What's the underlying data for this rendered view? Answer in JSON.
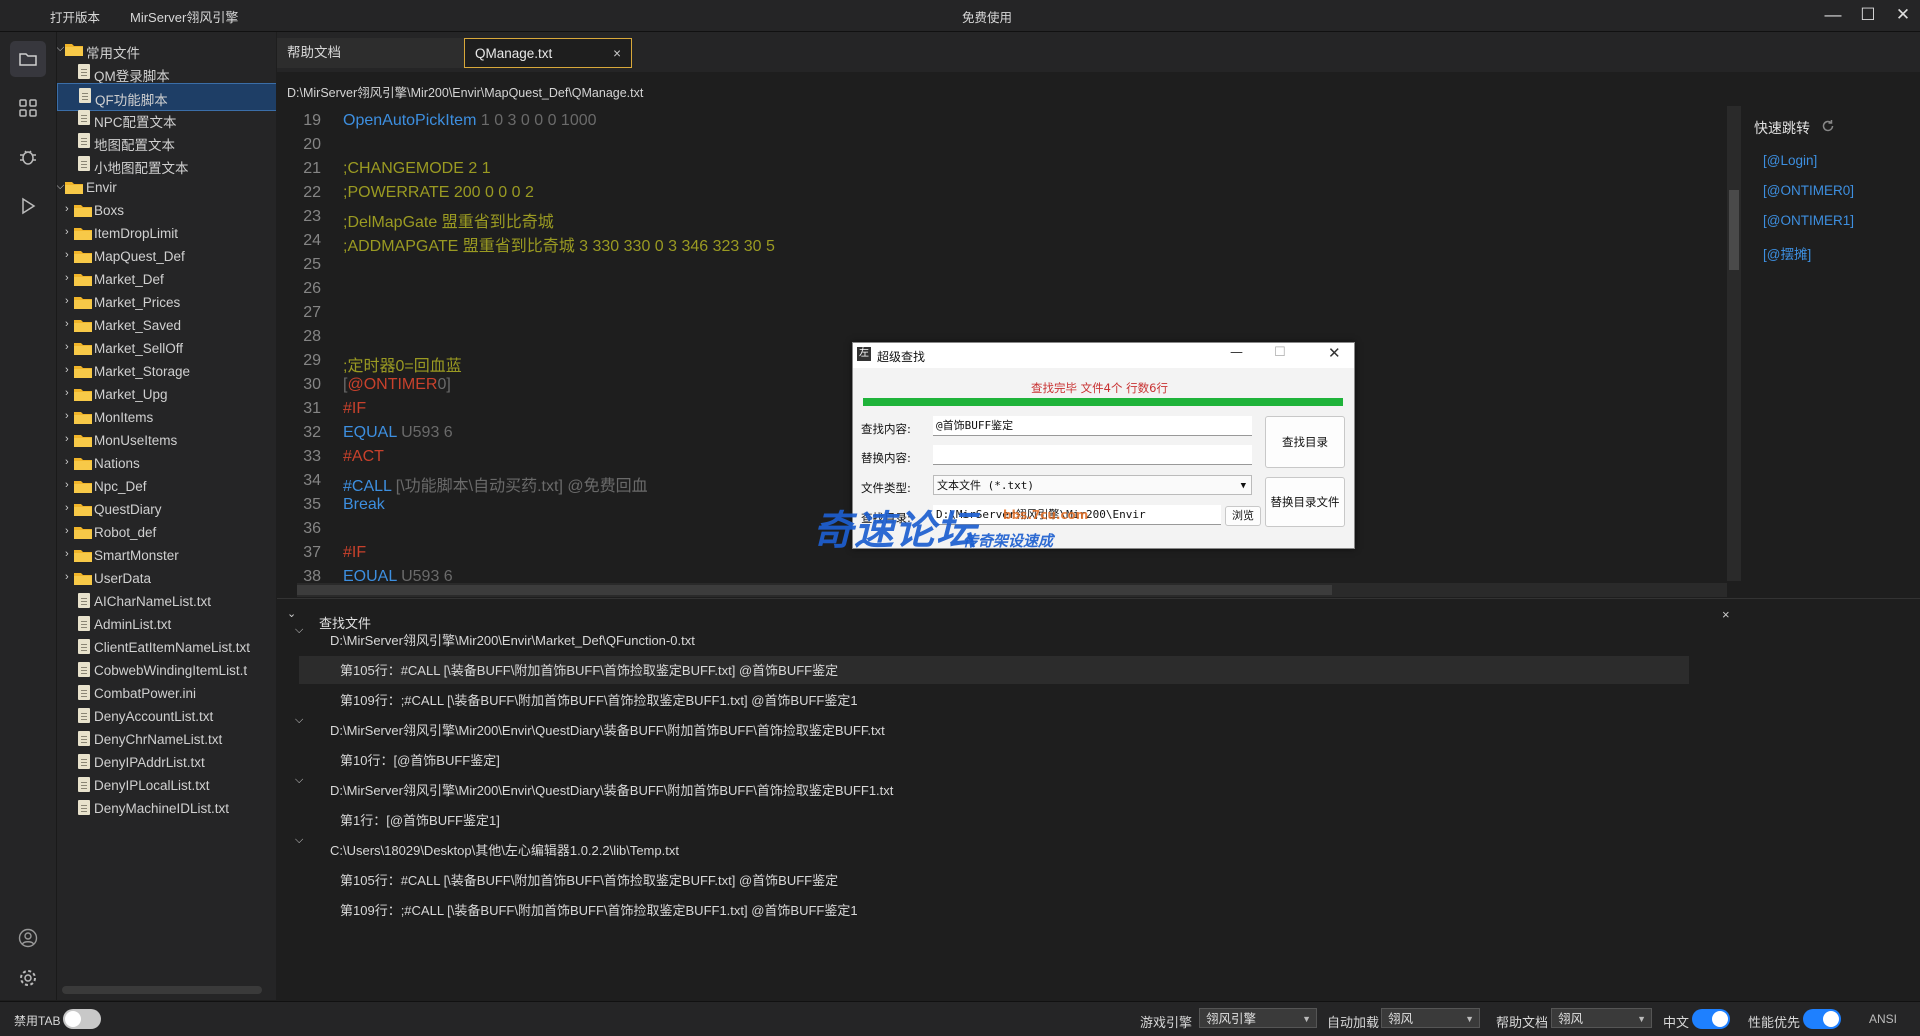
{
  "titlebar": {
    "open_version": "打开版本",
    "app_title": "MirServer翎风引擎",
    "center_label": "免费使用",
    "minimize": "—",
    "maximize": "☐",
    "close": "✕"
  },
  "sidebar_icons": [
    "folder-icon",
    "apps-grid-icon",
    "debug-bug-icon",
    "run-play-icon",
    "account-icon",
    "settings-gear-icon"
  ],
  "tree": {
    "groups": [
      {
        "label": "常用文件"
      },
      {
        "label": "Envir"
      }
    ],
    "common_files": [
      "QM登录脚本",
      "QF功能脚本",
      "NPC配置文本",
      "地图配置文本",
      "小地图配置文本"
    ],
    "envir_folders": [
      "Boxs",
      "ItemDropLimit",
      "MapQuest_Def",
      "Market_Def",
      "Market_Prices",
      "Market_Saved",
      "Market_SellOff",
      "Market_Storage",
      "Market_Upg",
      "MonItems",
      "MonUseItems",
      "Nations",
      "Npc_Def",
      "QuestDiary",
      "Robot_def",
      "SmartMonster",
      "UserData"
    ],
    "envir_files": [
      "AICharNameList.txt",
      "AdminList.txt",
      "ClientEatItemNameList.txt",
      "CobwebWindingItemList.t",
      "CombatPower.ini",
      "DenyAccountList.txt",
      "DenyChrNameList.txt",
      "DenyIPAddrList.txt",
      "DenyIPLocalList.txt",
      "DenyMachineIDList.txt"
    ]
  },
  "editor": {
    "tabs": [
      {
        "label": "帮助文档"
      },
      {
        "label": "QManage.txt",
        "close": "×"
      }
    ],
    "path": "D:\\MirServer翎风引擎\\Mir200\\Envir\\MapQuest_Def\\QManage.txt",
    "lines": [
      {
        "n": "19",
        "parts": [
          {
            "t": "OpenAutoPickItem",
            "c": "kw"
          },
          {
            "t": " 1 0 3 0 0 0 1000",
            "c": "gy"
          }
        ]
      },
      {
        "n": "20",
        "parts": []
      },
      {
        "n": "21",
        "parts": [
          {
            "t": ";CHANGEMODE 2 1",
            "c": "cm"
          }
        ]
      },
      {
        "n": "22",
        "parts": [
          {
            "t": ";POWERRATE 200 0 0 0 2",
            "c": "cm"
          }
        ]
      },
      {
        "n": "23",
        "parts": [
          {
            "t": ";DelMapGate 盟重省到比奇城",
            "c": "cm"
          }
        ]
      },
      {
        "n": "24",
        "parts": [
          {
            "t": ";ADDMAPGATE 盟重省到比奇城 3 330 330 0 3 346 323 30 5",
            "c": "cm"
          }
        ]
      },
      {
        "n": "25",
        "parts": []
      },
      {
        "n": "26",
        "parts": []
      },
      {
        "n": "27",
        "parts": []
      },
      {
        "n": "28",
        "parts": []
      },
      {
        "n": "29",
        "parts": [
          {
            "t": ";定时器0=回血蓝",
            "c": "cm"
          }
        ]
      },
      {
        "n": "30",
        "parts": [
          {
            "t": "[",
            "c": "gy"
          },
          {
            "t": "@ONTIMER",
            "c": "ev"
          },
          {
            "t": "0]",
            "c": "gy"
          }
        ]
      },
      {
        "n": "31",
        "parts": [
          {
            "t": "#IF",
            "c": "ev"
          }
        ]
      },
      {
        "n": "32",
        "parts": [
          {
            "t": "EQUAL",
            "c": "kw"
          },
          {
            "t": " U593 6",
            "c": "gy"
          }
        ]
      },
      {
        "n": "33",
        "parts": [
          {
            "t": "#ACT",
            "c": "ev"
          }
        ]
      },
      {
        "n": "34",
        "parts": [
          {
            "t": "#CALL",
            "c": "kw"
          },
          {
            "t": " [\\功能脚本\\自动买药.txt] @免费回血",
            "c": "gy"
          }
        ]
      },
      {
        "n": "35",
        "parts": [
          {
            "t": "Break",
            "c": "kw"
          }
        ]
      },
      {
        "n": "36",
        "parts": []
      },
      {
        "n": "37",
        "parts": [
          {
            "t": "#IF",
            "c": "ev"
          }
        ]
      },
      {
        "n": "38",
        "parts": [
          {
            "t": "EQUAL",
            "c": "kw"
          },
          {
            "t": " U593 6",
            "c": "gy"
          }
        ]
      }
    ]
  },
  "quick_jump": {
    "title": "快速跳转",
    "items": [
      "[@Login]",
      "[@ONTIMER0]",
      "[@ONTIMER1]",
      "[@摆摊]"
    ]
  },
  "results": {
    "title": "查找文件",
    "close": "×",
    "rows": [
      {
        "kind": "file",
        "text": "D:\\MirServer翎风引擎\\Mir200\\Envir\\Market_Def\\QFunction-0.txt"
      },
      {
        "kind": "hit",
        "text": "第105行：#CALL [\\装备BUFF\\附加首饰BUFF\\首饰捡取鉴定BUFF.txt] @首饰BUFF鉴定",
        "hl": true
      },
      {
        "kind": "hit",
        "text": "第109行：;#CALL [\\装备BUFF\\附加首饰BUFF\\首饰捡取鉴定BUFF1.txt] @首饰BUFF鉴定1"
      },
      {
        "kind": "file",
        "text": "D:\\MirServer翎风引擎\\Mir200\\Envir\\QuestDiary\\装备BUFF\\附加首饰BUFF\\首饰捡取鉴定BUFF.txt"
      },
      {
        "kind": "hit",
        "text": "第10行：[@首饰BUFF鉴定]"
      },
      {
        "kind": "file",
        "text": "D:\\MirServer翎风引擎\\Mir200\\Envir\\QuestDiary\\装备BUFF\\附加首饰BUFF\\首饰捡取鉴定BUFF1.txt"
      },
      {
        "kind": "hit",
        "text": "第1行：[@首饰BUFF鉴定1]"
      },
      {
        "kind": "file",
        "text": "C:\\Users\\18029\\Desktop\\其他\\左心编辑器1.0.2.2\\lib\\Temp.txt"
      },
      {
        "kind": "hit",
        "text": "第105行：#CALL [\\装备BUFF\\附加首饰BUFF\\首饰捡取鉴定BUFF.txt] @首饰BUFF鉴定"
      },
      {
        "kind": "hit",
        "text": "第109行：;#CALL [\\装备BUFF\\附加首饰BUFF\\首饰捡取鉴定BUFF1.txt] @首饰BUFF鉴定1"
      }
    ]
  },
  "dialog": {
    "icon_char": "左",
    "title": "超级查找",
    "status": "查找完毕 文件4个 行数6行",
    "progress": 1.0,
    "find_label": "查找内容:",
    "find_value": "@首饰BUFF鉴定",
    "replace_label": "替换内容:",
    "replace_value": "",
    "type_label": "文件类型:",
    "type_value": "文本文件 (*.txt)",
    "dir_label": "查找目录:",
    "dir_value": "D:\\MirServer翎风引擎\\Mir200\\Envir",
    "browse": "浏览",
    "find_dir_button": "查找目录",
    "replace_dir_button": "替换目录文件",
    "watermark_main": "奇速论坛",
    "watermark_sub": "传奇架设速成",
    "watermark_url": "bbs.7cu.com"
  },
  "statusbar": {
    "disable_tab": "禁用TAB",
    "game_engine_label": "游戏引擎",
    "game_engine_value": "翎风引擎",
    "autoload_label": "自动加载",
    "autoload_value": "翎风",
    "help_doc_label": "帮助文档",
    "help_doc_value": "翎风",
    "chinese_label": "中文",
    "perf_label": "性能优先",
    "encoding": "ANSI"
  },
  "colors": {
    "accent": "#1e80ff",
    "tab_active_border": "#d8a83a",
    "progress_green": "#1fb33a",
    "status_red": "#c83232"
  }
}
